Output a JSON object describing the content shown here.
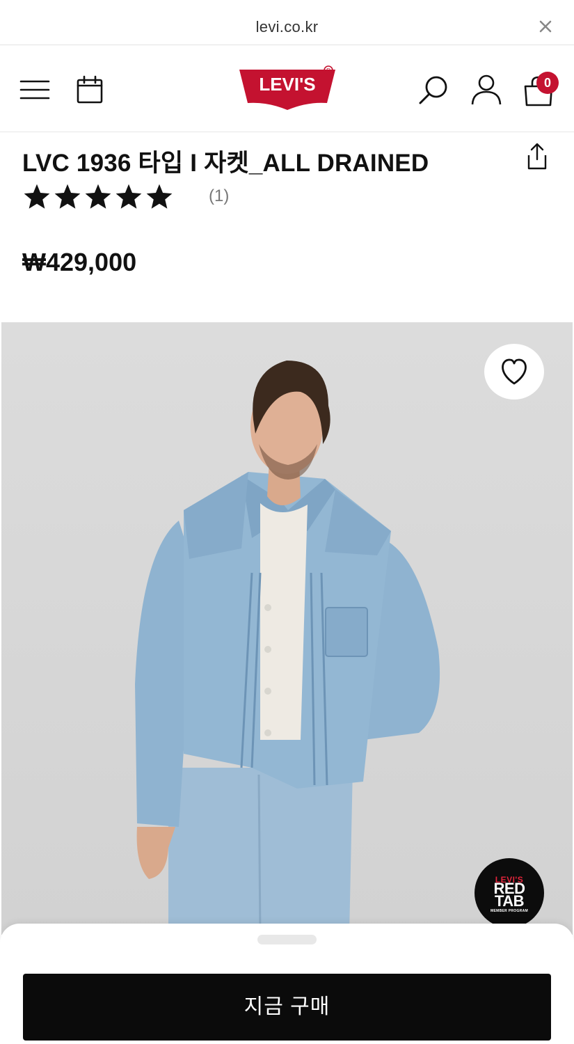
{
  "browser": {
    "url": "levi.co.kr"
  },
  "header": {
    "logo_text": "LEVI'S",
    "cart_count": "0"
  },
  "product": {
    "title": "LVC 1936 타입 I 자켓_ALL DRAINED",
    "rating": 5,
    "rating_max": 5,
    "review_count": "(1)",
    "price": "₩429,000"
  },
  "badges": {
    "redtab_line1": "LEVI'S",
    "redtab_line2": "RED",
    "redtab_line3": "TAB",
    "redtab_line4": "MEMBER PROGRAM"
  },
  "cta": {
    "buy_now_label": "지금 구매"
  },
  "colors": {
    "brand_red": "#c41230",
    "cta_black": "#0b0b0b",
    "image_background": "#d8d8d8"
  },
  "icons": [
    "close-icon",
    "menu-icon",
    "calendar-icon",
    "search-icon",
    "user-icon",
    "cart-icon",
    "share-icon",
    "star-icon",
    "heart-icon"
  ]
}
